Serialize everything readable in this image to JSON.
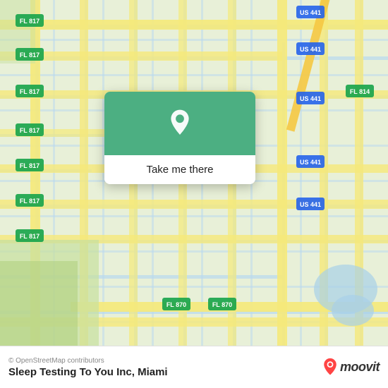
{
  "map": {
    "background_color": "#e8f0d8",
    "alt": "Street map of Miami area"
  },
  "popup": {
    "button_label": "Take me there",
    "pin_color": "#ffffff",
    "bg_color": "#4caf82"
  },
  "bottom_bar": {
    "copyright": "© OpenStreetMap contributors",
    "place_name": "Sleep Testing To You Inc",
    "city": "Miami",
    "place_full": "Sleep Testing To You Inc, Miami",
    "logo_text": "moovit"
  }
}
